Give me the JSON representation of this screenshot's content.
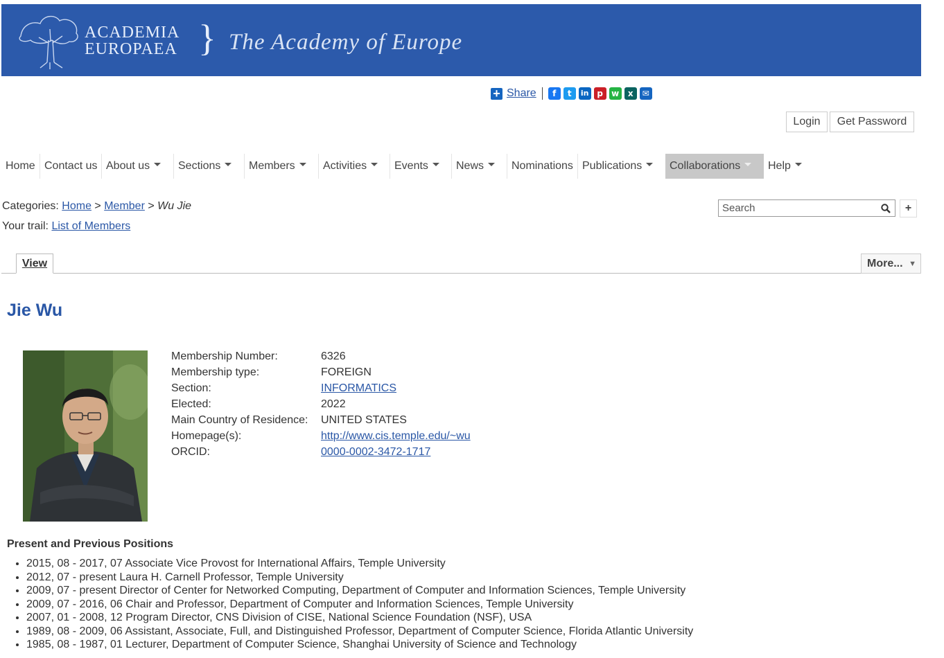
{
  "banner": {
    "logo_line1": "ACADEMIA",
    "logo_line2": "EUROPAEA",
    "brace": "}",
    "tagline": "The Academy of Europe",
    "color": "#2c5aab"
  },
  "share": {
    "label": "Share",
    "icons": [
      "facebook-icon",
      "twitter-icon",
      "linkedin-icon",
      "pinterest-icon",
      "whatsapp-icon",
      "xing-icon",
      "email-icon"
    ]
  },
  "auth": {
    "login": "Login",
    "get_password": "Get Password"
  },
  "nav": {
    "items": [
      {
        "label": "Home"
      },
      {
        "label": "Contact us"
      },
      {
        "label": "About us"
      },
      {
        "label": "Sections"
      },
      {
        "label": "Members"
      },
      {
        "label": "Activities"
      },
      {
        "label": "Events"
      },
      {
        "label": "News"
      },
      {
        "label": "Nominations"
      },
      {
        "label": "Publications"
      },
      {
        "label": "Collaborations"
      },
      {
        "label": "Help"
      }
    ]
  },
  "breadcrumb": {
    "prefix": "Categories:",
    "home": "Home",
    "sep": ">",
    "member": "Member",
    "current": "Wu Jie",
    "trail_prefix": "Your trail:",
    "trail_link": "List of Members"
  },
  "search": {
    "placeholder": "Search",
    "add": "+"
  },
  "tabs": {
    "view": "View",
    "more": "More...",
    "more_arrow": "▼"
  },
  "member": {
    "name": "Jie Wu",
    "fields": [
      {
        "label": "Membership Number:",
        "value": "6326"
      },
      {
        "label": "Membership type:",
        "value": "FOREIGN"
      },
      {
        "label": "Section:",
        "value": "INFORMATICS"
      },
      {
        "label": "Elected:",
        "value": "2022"
      },
      {
        "label": "Main Country of Residence:",
        "value": "UNITED STATES"
      },
      {
        "label": "Homepage(s):",
        "value": "http://www.cis.temple.edu/~wu"
      },
      {
        "label": "ORCID:",
        "value": "0000-0002-3472-1717"
      }
    ]
  },
  "positions": {
    "heading": "Present and Previous Positions",
    "items": [
      "2015, 08 - 2017, 07 Associate Vice Provost for International Affairs, Temple University",
      "2012, 07 - present Laura H. Carnell Professor, Temple University",
      "2009, 07 - present Director of Center for Networked Computing, Department of Computer and Information Sciences, Temple University",
      "2009, 07 - 2016, 06 Chair and Professor, Department of Computer and Information Sciences, Temple University",
      "2007, 01 - 2008, 12 Program Director, CNS Division of CISE, National Science Foundation (NSF), USA",
      "1989, 08 - 2009, 06 Assistant, Associate, Full, and Distinguished Professor, Department of Computer Science, Florida Atlantic University",
      "1985, 08 - 1987, 01 Lecturer, Department of Computer Science, Shanghai University of Science and Technology"
    ]
  }
}
